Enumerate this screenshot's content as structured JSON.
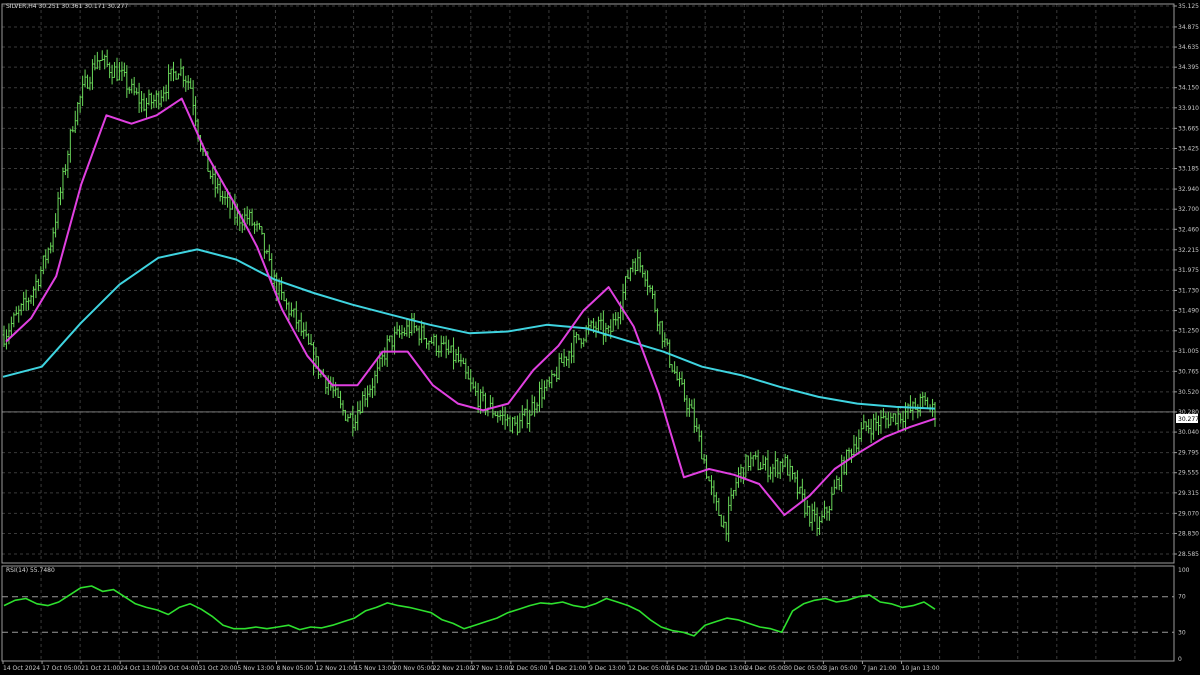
{
  "colors": {
    "background": "#000000",
    "grid": "#3a3a3a",
    "frame": "#9a9a9a",
    "candle": "#6ad85a",
    "ma_fast": "#e040e0",
    "ma_slow": "#3fd4e0",
    "rsi_line": "#2ee02e",
    "price_tag_bg": "#ffffff",
    "price_tag_text": "#000000"
  },
  "main_panel": {
    "info": "SILVER,H4  30.251 30.361 30.171 30.277",
    "price_tag": "30.277"
  },
  "rsi_panel": {
    "info": "RSI(14) 55.7480",
    "levels": [
      70,
      30
    ],
    "scale_labels": [
      "100",
      "70",
      "30",
      "0"
    ]
  },
  "chart_data": [
    {
      "type": "line",
      "title": "",
      "symbol": "SILVER",
      "timeframe": "H4",
      "y_tick_labels": [
        "35.125",
        "34.875",
        "34.635",
        "34.395",
        "34.150",
        "33.910",
        "33.665",
        "33.425",
        "33.185",
        "32.940",
        "32.700",
        "32.460",
        "32.215",
        "31.975",
        "31.730",
        "31.490",
        "31.250",
        "31.005",
        "30.765",
        "30.520",
        "30.280",
        "30.040",
        "29.795",
        "29.555",
        "29.315",
        "29.070",
        "28.830",
        "28.585"
      ],
      "x_tick_labels": [
        "14 Oct 2024",
        "17 Oct 05:00",
        "21 Oct 21:00",
        "24 Oct 13:00",
        "29 Oct 04:00",
        "31 Oct 20:00",
        "5 Nov 13:00",
        "8 Nov 05:00",
        "12 Nov 21:00",
        "15 Nov 13:00",
        "20 Nov 05:00",
        "22 Nov 21:00",
        "27 Nov 13:00",
        "2 Dec 05:00",
        "4 Dec 21:00",
        "9 Dec 13:00",
        "12 Dec 05:00",
        "16 Dec 21:00",
        "19 Dec 13:00",
        "24 Dec 05:00",
        "30 Dec 05:00",
        "3 Jan 05:00",
        "7 Jan 21:00",
        "10 Jan 13:00"
      ],
      "ylim": [
        28.585,
        35.125
      ],
      "grid": true,
      "series": [
        {
          "role": "price",
          "values": [
            31.2,
            31.4,
            31.6,
            31.9,
            32.3,
            33.0,
            33.8,
            34.2,
            34.5,
            34.4,
            34.3,
            34.1,
            33.95,
            34.0,
            34.2,
            34.4,
            34.2,
            33.4,
            33.0,
            32.8,
            32.6,
            32.6,
            32.4,
            31.9,
            31.6,
            31.4,
            31.1,
            30.8,
            30.6,
            30.3,
            30.2,
            30.5,
            30.7,
            31.1,
            31.2,
            31.3,
            31.2,
            31.1,
            31.0,
            30.9,
            30.6,
            30.4,
            30.3,
            30.2,
            30.1,
            30.25,
            30.5,
            30.6,
            30.9,
            31.1,
            31.25,
            31.3,
            31.2,
            31.6,
            32.1,
            32.0,
            31.5,
            31.0,
            30.6,
            30.3,
            29.8,
            29.2,
            28.9,
            29.5,
            29.7,
            29.65,
            29.6,
            29.7,
            29.4,
            29.1,
            28.9,
            29.2,
            29.6,
            29.9,
            30.1,
            30.15,
            30.2,
            30.25,
            30.3,
            30.4,
            30.28
          ]
        },
        {
          "role": "fast moving average",
          "values": [
            31.12,
            31.4,
            31.9,
            33.0,
            33.82,
            33.72,
            33.82,
            34.02,
            33.35,
            32.82,
            32.25,
            31.5,
            30.95,
            30.6,
            30.6,
            31.0,
            31.0,
            30.6,
            30.38,
            30.3,
            30.38,
            30.78,
            31.07,
            31.49,
            31.77,
            31.3,
            30.5,
            29.5,
            29.6,
            29.53,
            29.42,
            29.05,
            29.28,
            29.6,
            29.8,
            29.98,
            30.1,
            30.2
          ]
        },
        {
          "role": "slow moving average",
          "values": [
            30.7,
            30.82,
            31.34,
            31.8,
            32.12,
            32.22,
            32.1,
            31.86,
            31.7,
            31.56,
            31.44,
            31.32,
            31.22,
            31.24,
            31.32,
            31.28,
            31.14,
            31.0,
            30.82,
            30.72,
            30.58,
            30.46,
            30.38,
            30.34,
            30.32
          ]
        }
      ]
    },
    {
      "type": "line",
      "title": "",
      "indicator": "RSI(14)",
      "last_value": 55.748,
      "ylim": [
        0,
        100
      ],
      "levels": [
        70,
        30
      ],
      "values": [
        60,
        66,
        68,
        62,
        60,
        64,
        72,
        80,
        82,
        76,
        78,
        70,
        62,
        58,
        55,
        50,
        58,
        62,
        56,
        48,
        38,
        34,
        34,
        36,
        34,
        36,
        38,
        33,
        36,
        35,
        38,
        42,
        46,
        54,
        58,
        63,
        60,
        58,
        55,
        52,
        44,
        40,
        34,
        38,
        42,
        46,
        52,
        56,
        60,
        63,
        62,
        64,
        60,
        58,
        62,
        68,
        64,
        60,
        54,
        44,
        36,
        32,
        30,
        26,
        38,
        42,
        46,
        44,
        40,
        36,
        34,
        30,
        54,
        62,
        66,
        68,
        64,
        66,
        70,
        72,
        64,
        62,
        58,
        60,
        64,
        56
      ]
    }
  ]
}
